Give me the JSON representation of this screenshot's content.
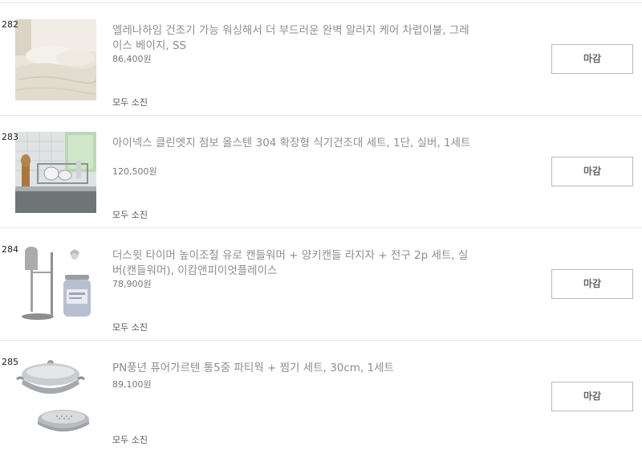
{
  "items": [
    {
      "rank": "282",
      "title": "엘레나하임 건조기 가능 워싱해서 더 부드러운 완벽 알러지 케어 차렵이불, 그레이스 베이지, SS",
      "price": "86,400원",
      "status": "모두 소진",
      "button": "마감"
    },
    {
      "rank": "283",
      "title": "아이넥스 클린엣지 점보 올스텐 304 확장형 식기건조대 세트, 1단, 실버, 1세트",
      "price": "120,500원",
      "status": "모두 소진",
      "button": "마감"
    },
    {
      "rank": "284",
      "title": "더스윗 타이머 높이조절 유로 캔들워머 + 양키캔들 라지자 + 전구 2p 세트, 실버(캔들워머), 이캄앤피이엇플레이스",
      "price": "78,900원",
      "status": "모두 소진",
      "button": "마감"
    },
    {
      "rank": "285",
      "title": "PN풍년 퓨어가르텐 통5중 파티웍 + 찜기 세트, 30cm, 1세트",
      "price": "89,100원",
      "status": "모두 소진",
      "button": "마감"
    }
  ]
}
